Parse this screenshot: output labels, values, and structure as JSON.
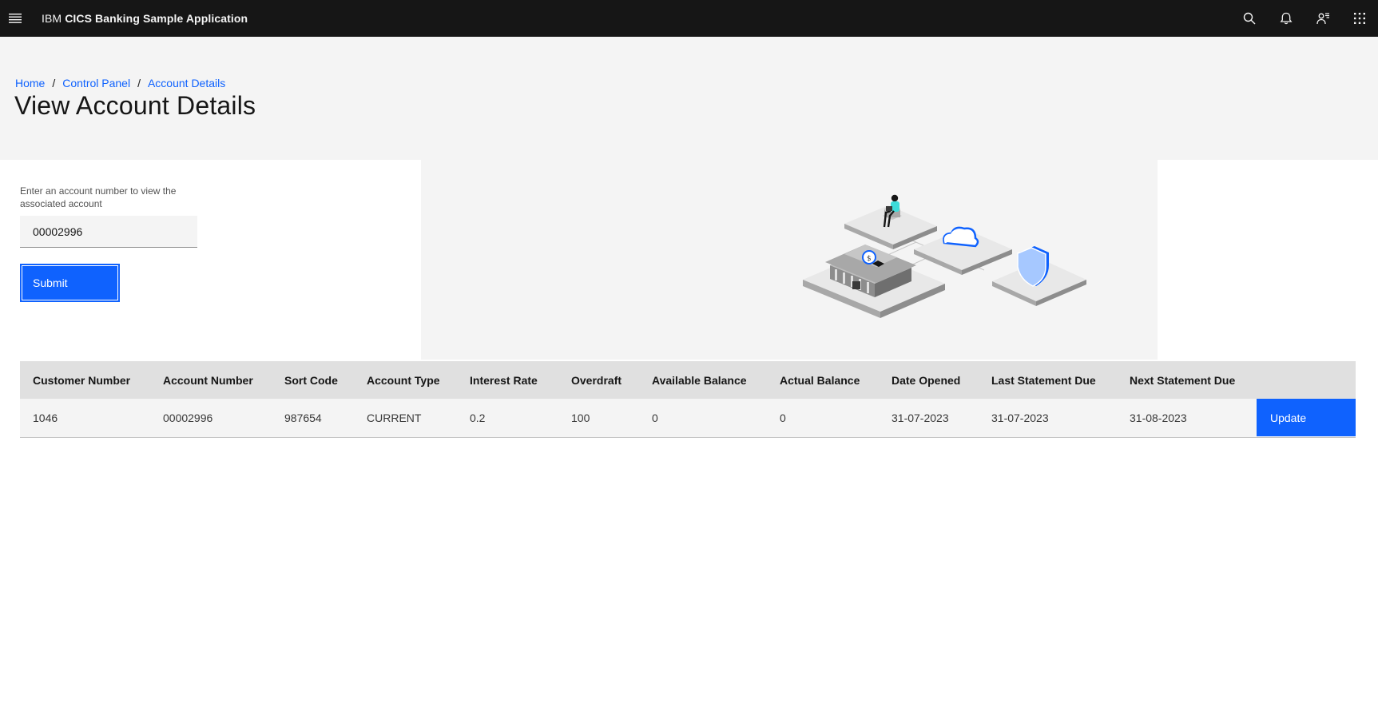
{
  "header": {
    "prefix": "IBM",
    "app_name": "CICS Banking Sample Application",
    "icons": [
      "menu-icon",
      "search-icon",
      "notification-icon",
      "user-icon",
      "app-switcher-icon"
    ]
  },
  "breadcrumb": {
    "items": [
      "Home",
      "Control Panel",
      "Account Details"
    ],
    "separator": "/"
  },
  "page_title": "View Account Details",
  "form": {
    "label": "Enter an account number to view the associated account",
    "account_value": "00002996",
    "submit_label": "Submit"
  },
  "table": {
    "columns": [
      "Customer Number",
      "Account Number",
      "Sort Code",
      "Account Type",
      "Interest Rate",
      "Overdraft",
      "Available Balance",
      "Actual Balance",
      "Date Opened",
      "Last Statement Due",
      "Next Statement Due"
    ],
    "rows": [
      {
        "cells": [
          "1046",
          "00002996",
          "987654",
          "CURRENT",
          "0.2",
          "100",
          "0",
          "0",
          "31-07-2023",
          "31-07-2023",
          "31-08-2023"
        ],
        "action_label": "Update"
      }
    ]
  },
  "colors": {
    "header_bg": "#161616",
    "accent": "#0f62fe",
    "band_bg": "#f4f4f4",
    "table_header_bg": "#e0e0e0"
  }
}
